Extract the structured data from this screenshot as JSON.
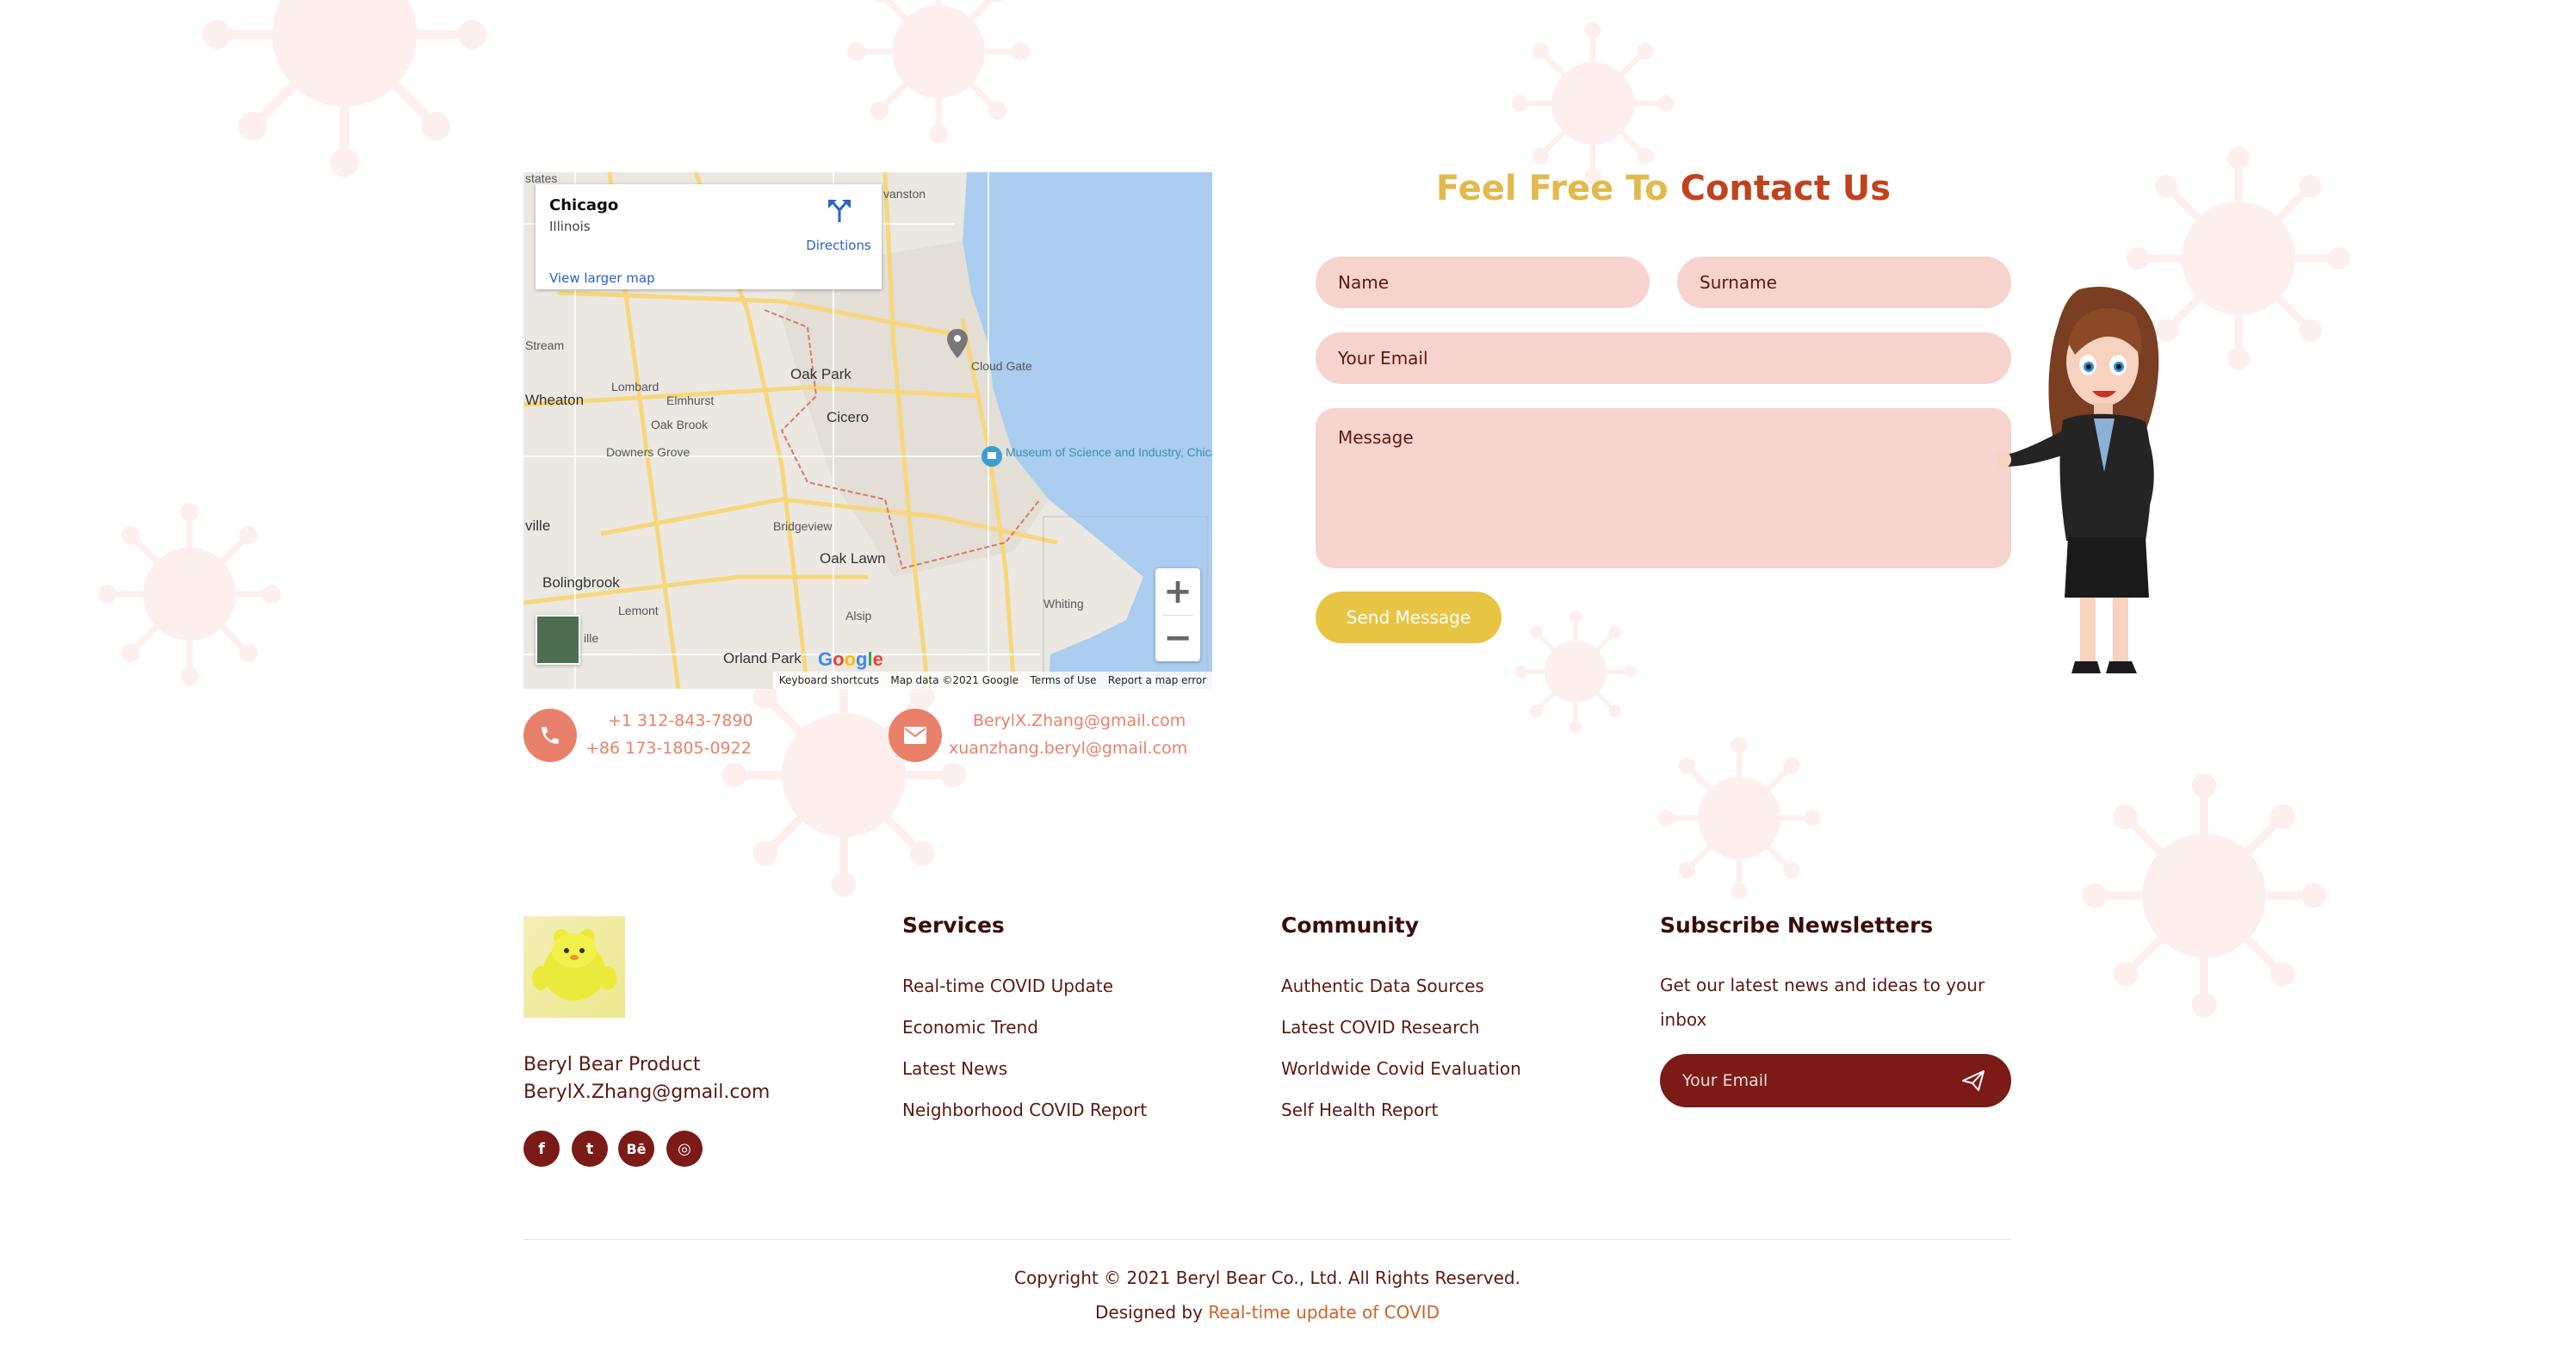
{
  "colors": {
    "title_gold": "#e1b94c",
    "title_rust": "#c0431d",
    "field_bg": "#f6d3cd",
    "button_gold": "#e8c445",
    "contact_icon": "#e9806a",
    "footer_dark": "#7b1a16",
    "text_dark": "#5a1a12",
    "link_orange": "#c8642a"
  },
  "map": {
    "place_name": "Chicago",
    "place_region": "Illinois",
    "view_larger": "View larger map",
    "directions": "Directions",
    "zoom_in": "+",
    "zoom_out": "−",
    "labels": {
      "states": "states",
      "evanston": "vanston",
      "stream": "Stream",
      "elmhurst": "Elmhurst",
      "lombard": "Lombard",
      "wheaton": "Wheaton",
      "oak_park": "Oak Park",
      "oak_brook": "Oak Brook",
      "cicero": "Cicero",
      "downers_grove": "Downers Grove",
      "cloud_gate": "Cloud Gate",
      "museum": "Museum of Science and Industry, Chicago",
      "bridgeview": "Bridgeview",
      "oak_lawn": "Oak Lawn",
      "ville": "ville",
      "bolingbrook": "Bolingbrook",
      "lemont": "Lemont",
      "alsip": "Alsip",
      "whiting": "Whiting",
      "orland_park": "Orland Park",
      "ille": "ille"
    },
    "google": "Google",
    "footer": {
      "shortcuts": "Keyboard shortcuts",
      "data": "Map data ©2021 Google",
      "terms": "Terms of Use",
      "report": "Report a map error"
    },
    "icons": {
      "directions": "directions-icon",
      "pin": "map-pin-icon",
      "museum": "museum-pin-icon",
      "zoom_in": "zoom-in-icon",
      "zoom_out": "zoom-out-icon"
    }
  },
  "contact_info": {
    "phone_icon": "phone-icon",
    "phone_1": "+1 312-843-7890",
    "phone_2": "+86 173-1805-0922",
    "mail_icon": "envelope-icon",
    "email_1": "BerylX.Zhang@gmail.com",
    "email_2": "xuanzhang.beryl@gmail.com"
  },
  "form": {
    "title_part1": "Feel Free To",
    "title_part2": "Contact Us",
    "name_placeholder": "Name",
    "surname_placeholder": "Surname",
    "email_placeholder": "Your Email",
    "message_placeholder": "Message",
    "send_label": "Send Message"
  },
  "footer": {
    "brand_name": "Beryl Bear Product",
    "brand_email": "BerylX.Zhang@gmail.com",
    "social": [
      {
        "icon": "facebook-icon",
        "glyph": "f"
      },
      {
        "icon": "twitter-icon",
        "glyph": "t"
      },
      {
        "icon": "behance-icon",
        "glyph": "Bē"
      },
      {
        "icon": "instagram-icon",
        "glyph": "◎"
      }
    ],
    "services": {
      "title": "Services",
      "links": [
        "Real-time COVID Update",
        "Economic Trend",
        "Latest News",
        "Neighborhood COVID Report"
      ]
    },
    "community": {
      "title": "Community",
      "links": [
        "Authentic Data Sources",
        "Latest COVID Research",
        "Worldwide Covid Evaluation",
        "Self Health Report"
      ]
    },
    "newsletter": {
      "title": "Subscribe Newsletters",
      "text": "Get our latest news and ideas to your inbox",
      "placeholder": "Your Email",
      "send_icon": "paper-plane-icon"
    },
    "copyright": "Copyright © 2021 Beryl Bear Co., Ltd. All Rights Reserved.",
    "designed_by": "Designed by",
    "designed_by_link": "Real-time update of COVID"
  }
}
